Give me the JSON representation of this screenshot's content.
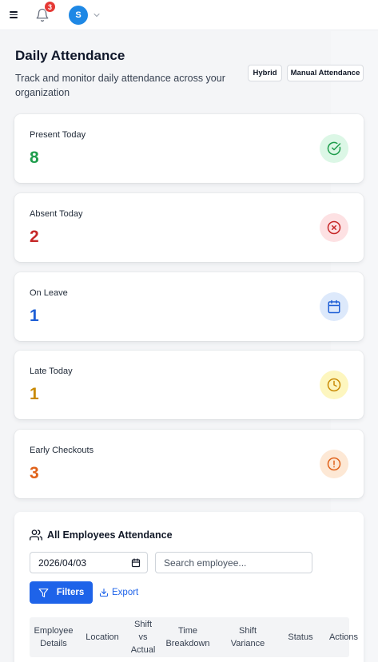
{
  "topbar": {
    "notification_count": "3",
    "avatar_initial": "S"
  },
  "header": {
    "title": "Daily Attendance",
    "subtitle": "Track and monitor daily attendance across your organization",
    "mode_buttons": [
      "Hybrid",
      "Manual Attendance"
    ]
  },
  "stats": [
    {
      "label": "Present Today",
      "value": "8",
      "color": "#1f9d4c",
      "icon": "check-circle-icon",
      "icon_bg": "#dcf7e6"
    },
    {
      "label": "Absent Today",
      "value": "2",
      "color": "#c62828",
      "icon": "x-circle-icon",
      "icon_bg": "#fde1e3"
    },
    {
      "label": "On Leave",
      "value": "1",
      "color": "#1e5fd6",
      "icon": "calendar-icon",
      "icon_bg": "#dde9fb"
    },
    {
      "label": "Late Today",
      "value": "1",
      "color": "#c98a06",
      "icon": "clock-icon",
      "icon_bg": "#fdf6bf"
    },
    {
      "label": "Early Checkouts",
      "value": "3",
      "color": "#e0621a",
      "icon": "alert-circle-icon",
      "icon_bg": "#fde8d5"
    }
  ],
  "attendance": {
    "title": "All Employees Attendance",
    "date_value": "2026/04/03",
    "search_placeholder": "Search employee...",
    "filters_label": "Filters",
    "export_label": "Export",
    "columns": [
      [
        "Employee",
        "Details"
      ],
      [
        "Location"
      ],
      [
        "Shift",
        "vs",
        "Actual"
      ],
      [
        "Time",
        "Breakdown"
      ],
      [
        "Shift",
        "Variance"
      ],
      [
        "Status"
      ],
      [
        "Actions"
      ]
    ]
  }
}
